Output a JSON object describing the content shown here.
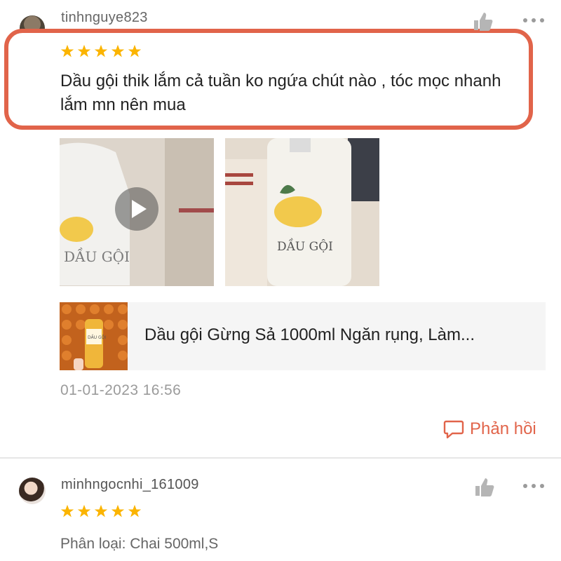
{
  "reviews": [
    {
      "username": "tinhnguye823",
      "rating": 5,
      "text": "Dầu gội thik lắm cả tuần ko ngứa chút nào , tóc mọc nhanh lắm mn nên mua",
      "media": [
        {
          "type": "video",
          "label": "DẦU GỘI"
        },
        {
          "type": "image",
          "label": "DẦU GỘI"
        }
      ],
      "product": {
        "thumb_label": "DẦU GỘI",
        "name": "Dầu gội Gừng Sả 1000ml Ngăn rụng, Làm..."
      },
      "timestamp": "01-01-2023 16:56",
      "reply_label": "Phản hồi"
    },
    {
      "username": "minhngocnhi_161009",
      "rating": 5,
      "variation": "Phân loại: Chai 500ml,S"
    }
  ],
  "colors": {
    "accent": "#e1644a",
    "star": "#fbb400",
    "muted": "#9b9b9b"
  },
  "icons": {
    "like": "thumbs-up-icon",
    "more": "more-options-icon",
    "play": "play-icon",
    "reply": "chat-bubble-icon",
    "star": "star-icon"
  }
}
